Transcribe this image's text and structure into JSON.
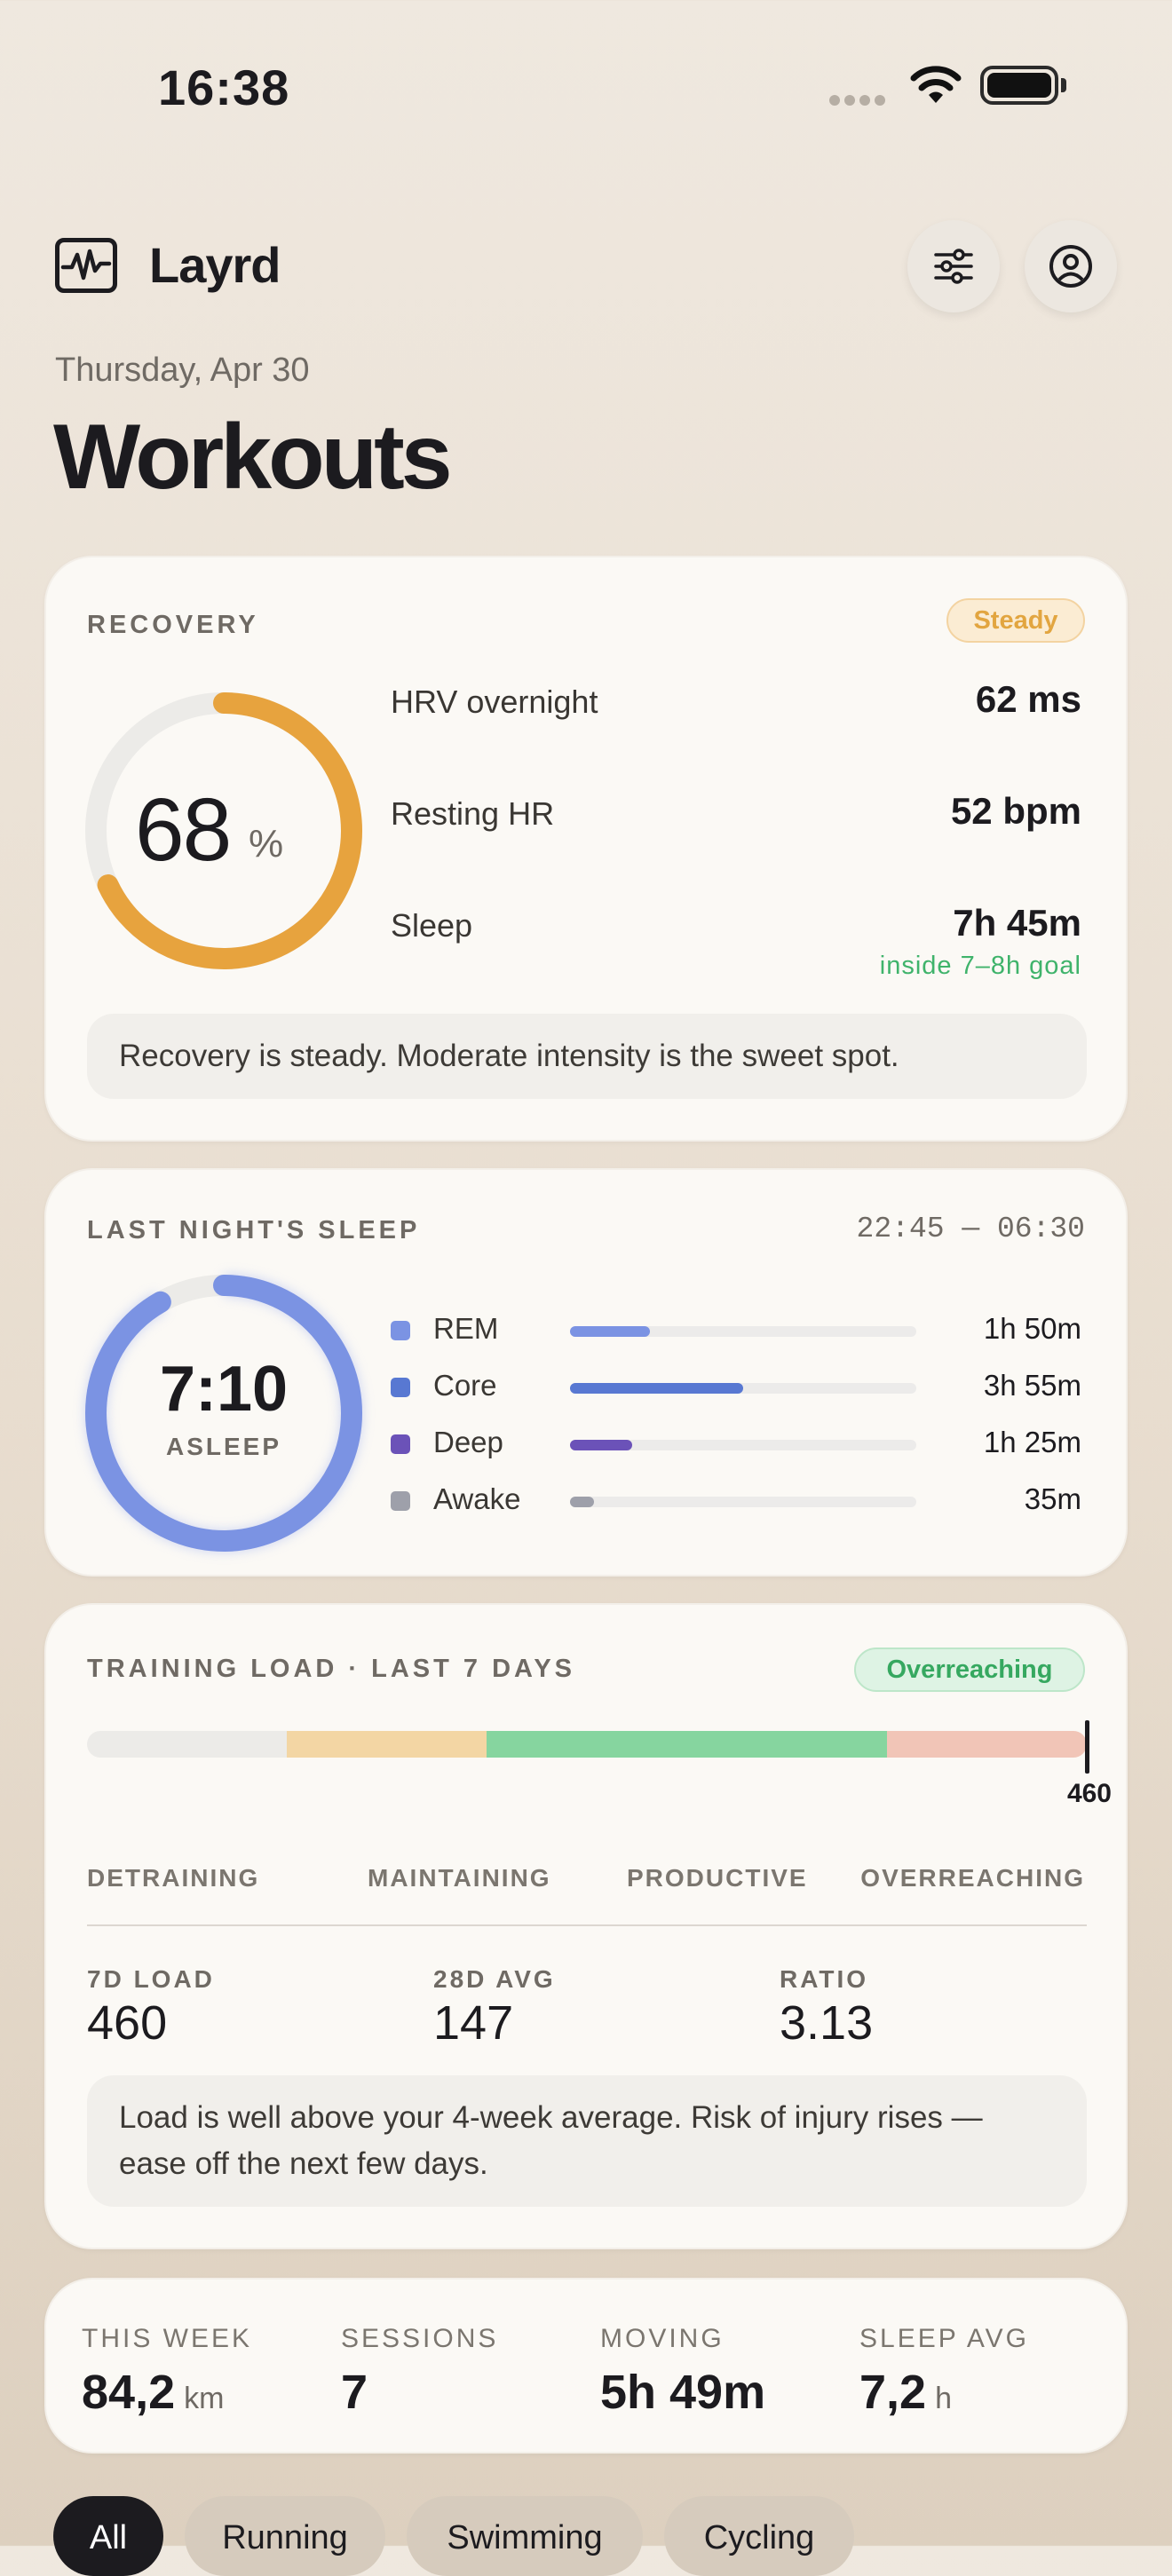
{
  "status_bar": {
    "time": "16:38"
  },
  "header": {
    "brand": "Layrd",
    "date": "Thursday, Apr 30",
    "title": "Workouts"
  },
  "icons": {
    "logo": "activity-monitor-icon",
    "filter": "sliders-icon",
    "profile": "user-circle-icon"
  },
  "recovery": {
    "label": "RECOVERY",
    "badge": "Steady",
    "percent": "68",
    "percent_sign": "%",
    "score": 0.68,
    "rows": [
      {
        "label": "HRV overnight",
        "value": "62 ms"
      },
      {
        "label": "Resting HR",
        "value": "52 bpm"
      },
      {
        "label": "Sleep",
        "value": "7h 45m"
      }
    ],
    "sleep_note": "inside 7–8h goal",
    "message": "Recovery is steady. Moderate intensity is the sweet spot."
  },
  "sleep": {
    "label": "LAST NIGHT'S SLEEP",
    "window": "22:45 — 06:30",
    "total": "7:10",
    "total_label": "ASLEEP",
    "stages": [
      {
        "name": "REM",
        "value": "1h 50m",
        "fraction": 0.23,
        "color": "#7b93e3"
      },
      {
        "name": "Core",
        "value": "3h 55m",
        "fraction": 0.5,
        "color": "#5878d2"
      },
      {
        "name": "Deep",
        "value": "1h 25m",
        "fraction": 0.18,
        "color": "#6b52b8"
      },
      {
        "name": "Awake",
        "value": "35m",
        "fraction": 0.07,
        "color": "#9ea0aa"
      }
    ]
  },
  "training": {
    "label": "TRAINING LOAD · LAST 7 DAYS",
    "badge": "Overreaching",
    "marker_value": "460",
    "zones": [
      "DETRAINING",
      "MAINTAINING",
      "PRODUCTIVE",
      "OVERREACHING"
    ],
    "stats": [
      {
        "label": "7D LOAD",
        "value": "460"
      },
      {
        "label": "28D AVG",
        "value": "147"
      },
      {
        "label": "RATIO",
        "value": "3.13"
      }
    ],
    "message": "Load is well above your 4-week average. Risk of injury rises — ease off the next few days."
  },
  "week": {
    "items": [
      {
        "label": "THIS WEEK",
        "value": "84,2",
        "unit": "km"
      },
      {
        "label": "SESSIONS",
        "value": "7",
        "unit": ""
      },
      {
        "label": "MOVING",
        "value": "5h 49m",
        "unit": ""
      },
      {
        "label": "SLEEP AVG",
        "value": "7,2",
        "unit": "h"
      }
    ]
  },
  "filters": [
    "All",
    "Running",
    "Swimming",
    "Cycling"
  ],
  "colors": {
    "accent_recovery": "#e7a33e",
    "sleep_ring": "#7b93e3",
    "good": "#3fb36b"
  }
}
